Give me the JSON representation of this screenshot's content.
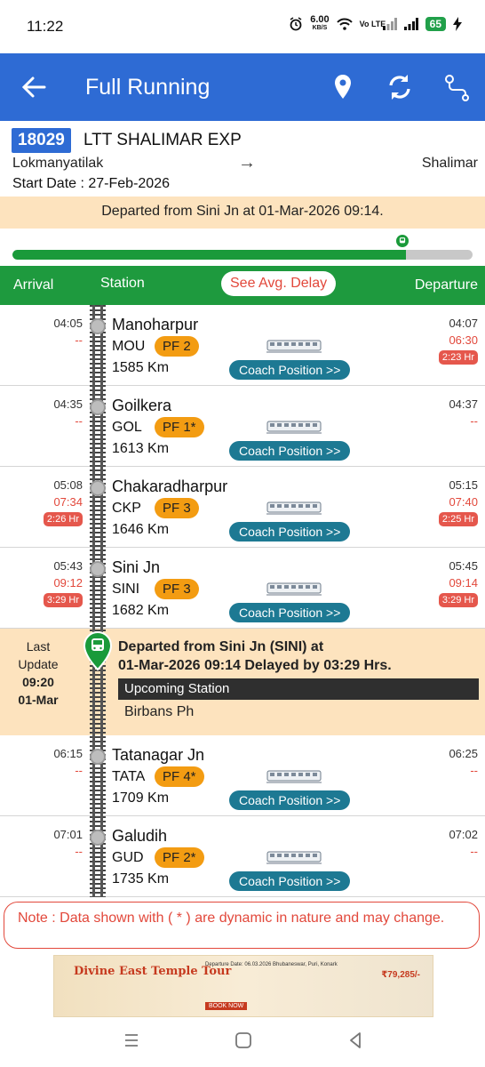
{
  "status_bar": {
    "time": "11:22",
    "net_speed_value": "6.00",
    "net_speed_unit": "KB/S",
    "volte": "Vo LTE",
    "battery": "65"
  },
  "app_bar": {
    "title": "Full Running",
    "icons": [
      "back-arrow-icon",
      "location-pin-icon",
      "refresh-icon",
      "route-icon"
    ]
  },
  "train": {
    "number": "18029",
    "name": "LTT SHALIMAR EXP",
    "from": "Lokmanyatilak",
    "arrow": "→",
    "to": "Shalimar",
    "start_date_label": "Start Date : ",
    "start_date": "27-Feb-2026"
  },
  "status_banner": "Departed from Sini Jn at 01-Mar-2026 09:14.",
  "progress": {
    "fraction": 0.855
  },
  "table_header": {
    "arrival": "Arrival",
    "station": "Station",
    "delay_button": "See Avg. Delay",
    "departure": "Departure"
  },
  "stations_before": [
    {
      "arr": "04:05",
      "arr_act": "--",
      "arr_delay": "",
      "dep": "04:07",
      "dep_act": "06:30",
      "dep_delay": "2:23 Hr",
      "name": "Manoharpur",
      "code": "MOU",
      "pf": "PF 2",
      "km": "1585 Km",
      "coach": "Coach Position >>"
    },
    {
      "arr": "04:35",
      "arr_act": "--",
      "arr_delay": "",
      "dep": "04:37",
      "dep_act": "--",
      "dep_delay": "",
      "name": "Goilkera",
      "code": "GOL",
      "pf": "PF 1*",
      "km": "1613 Km",
      "coach": "Coach Position >>"
    },
    {
      "arr": "05:08",
      "arr_act": "07:34",
      "arr_delay": "2:26 Hr",
      "dep": "05:15",
      "dep_act": "07:40",
      "dep_delay": "2:25 Hr",
      "name": "Chakaradharpur",
      "code": "CKP",
      "pf": "PF 3",
      "km": "1646 Km",
      "coach": "Coach Position >>"
    },
    {
      "arr": "05:43",
      "arr_act": "09:12",
      "arr_delay": "3:29 Hr",
      "dep": "05:45",
      "dep_act": "09:14",
      "dep_delay": "3:29 Hr",
      "name": "Sini Jn",
      "code": "SINI",
      "pf": "PF 3",
      "km": "1682 Km",
      "coach": "Coach Position >>"
    }
  ],
  "current": {
    "last_label": "Last",
    "update_label": "Update",
    "time": "09:20",
    "date": "01-Mar",
    "line1": "Departed from Sini Jn (SINI) at",
    "line2": "01-Mar-2026 09:14 Delayed by 03:29 Hrs.",
    "upcoming_label": "Upcoming Station",
    "upcoming_name": "Birbans Ph"
  },
  "stations_after": [
    {
      "arr": "06:15",
      "arr_act": "--",
      "arr_delay": "",
      "dep": "06:25",
      "dep_act": "--",
      "dep_delay": "",
      "name": "Tatanagar Jn",
      "code": "TATA",
      "pf": "PF 4*",
      "km": "1709 Km",
      "coach": "Coach Position >>"
    },
    {
      "arr": "07:01",
      "arr_act": "--",
      "arr_delay": "",
      "dep": "07:02",
      "dep_act": "--",
      "dep_delay": "",
      "name": "Galudih",
      "code": "GUD",
      "pf": "PF 2*",
      "km": "1735 Km",
      "coach": "Coach Position >>"
    }
  ],
  "note": "Note : Data shown with ( * ) are dynamic in nature and may change.",
  "ad": {
    "title": "Divine East Temple Tour",
    "body": "Departure Date: 06.03.2026 Bhubaneswar, Puri, Konark",
    "button": "BOOK NOW",
    "price": "₹79,285/-"
  },
  "colors": {
    "app_bar": "#2e6bd4",
    "header_green": "#1e9a3e",
    "banner": "#fde3be",
    "delay_red": "#e2483b",
    "pf_orange": "#f39c12",
    "coach_teal": "#1d7993"
  }
}
